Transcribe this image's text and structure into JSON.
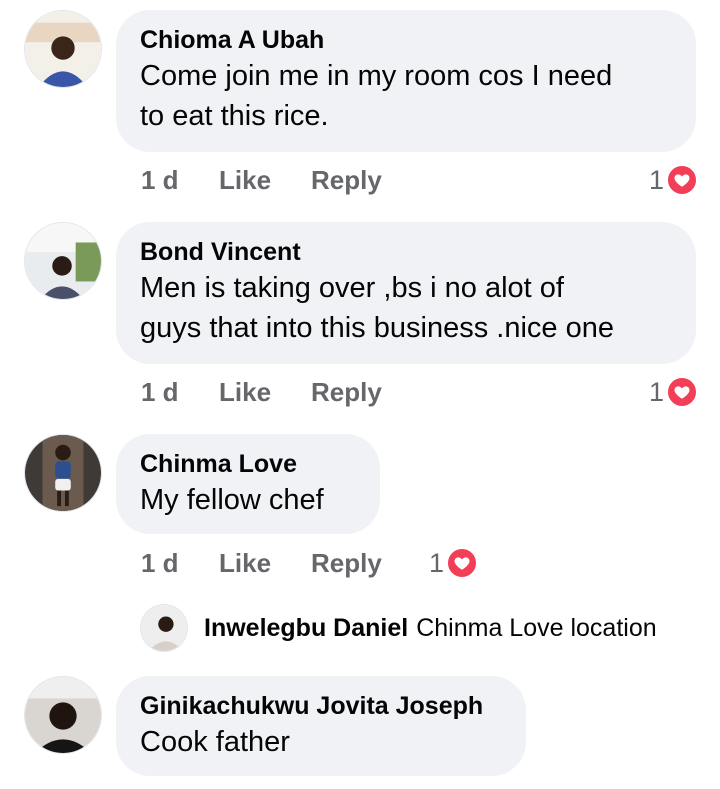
{
  "colors": {
    "bubble": "#f0f2f5",
    "secondary_text": "#65676b",
    "heart": "#f33e58",
    "primary_text": "#050505"
  },
  "comments": [
    {
      "author": "Chioma A Ubah",
      "lines": [
        "Come join me in my room cos I need",
        "to eat this rice."
      ],
      "time": "1 d",
      "like_label": "Like",
      "reply_label": "Reply",
      "reaction_count": "1",
      "reaction_icon": "heart-icon"
    },
    {
      "author": "Bond Vincent",
      "lines": [
        "Men is taking over ,bs i no alot of",
        "guys that into this business .nice one"
      ],
      "time": "1 d",
      "like_label": "Like",
      "reply_label": "Reply",
      "reaction_count": "1",
      "reaction_icon": "heart-icon"
    },
    {
      "author": "Chinma Love",
      "lines": [
        "My fellow chef"
      ],
      "time": "1 d",
      "like_label": "Like",
      "reply_label": "Reply",
      "reaction_count": "1",
      "reaction_icon": "heart-icon",
      "reply_preview": {
        "author": "Inwelegbu Daniel",
        "text": "Chinma Love location"
      }
    },
    {
      "author": "Ginikachukwu Jovita Joseph",
      "lines": [
        "Cook father"
      ]
    }
  ]
}
